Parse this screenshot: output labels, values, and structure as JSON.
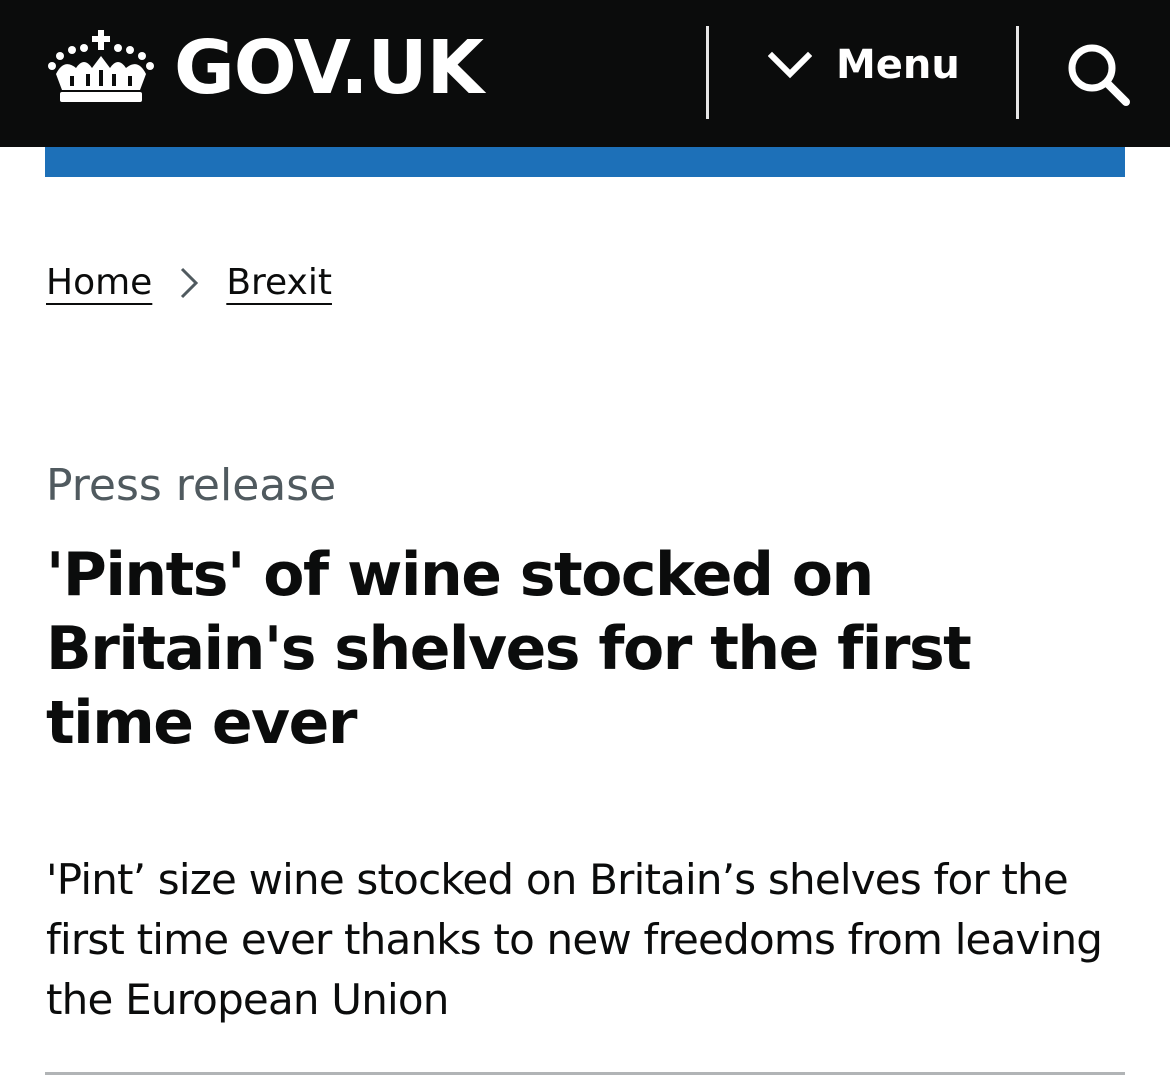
{
  "header": {
    "logo_text": "GOV.UK",
    "menu_label": "Menu",
    "icons": {
      "logo": "crown-icon",
      "menu": "chevron-down-icon",
      "search": "search-icon"
    }
  },
  "breadcrumb": {
    "items": [
      {
        "label": "Home"
      },
      {
        "label": "Brexit"
      }
    ],
    "separator_icon": "chevron-right-icon"
  },
  "content": {
    "caption": "Press release",
    "title": "'Pints' of wine stocked on Britain's shelves for the first time ever",
    "lead": "'Pint’ size wine stocked on Britain’s shelves for the first time ever thanks to new freedoms from leaving the European Union"
  },
  "colors": {
    "header_bg": "#0b0c0c",
    "brand_blue": "#1d70b8",
    "text": "#0b0c0c",
    "caption_grey": "#505a5f",
    "rule_grey": "#b1b4b6"
  }
}
